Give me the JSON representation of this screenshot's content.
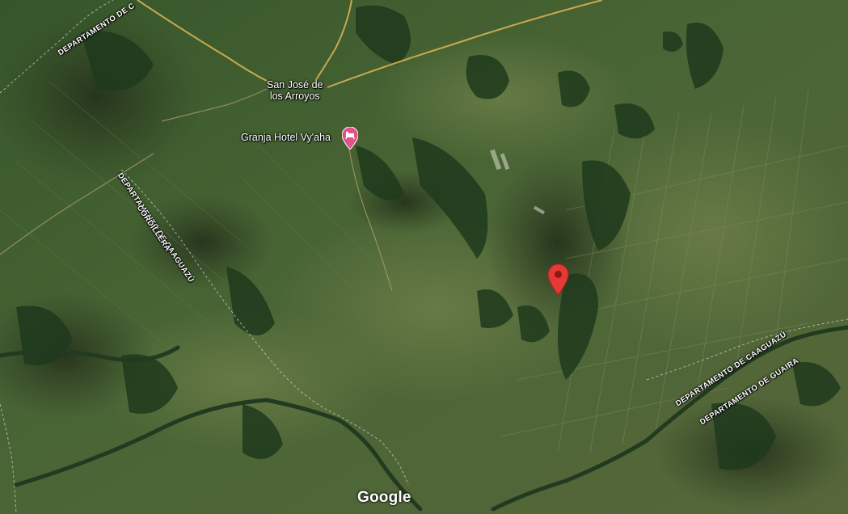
{
  "map": {
    "view": "satellite",
    "place_labels": {
      "town": "San José de los Arroyos",
      "town_line1": "San José de",
      "town_line2": "los Arroyos",
      "hotel": "Granja Hotel Vy'aha"
    },
    "department_labels": {
      "top_left_partial": "DEPARTAMENTO DE C",
      "caaguazu_left": "DEPARTAMENTO DE CAAGUAZÚ",
      "cordillera": "CORDILLERA",
      "caaguazu_right": "DEPARTAMENTO DE CAAGUAZÚ",
      "guaira": "DEPARTAMENTO DE GUAIRA"
    },
    "markers": {
      "selected_pin": "red-location-pin",
      "hotel_pin": "hotel-bed-pin"
    },
    "attribution": {
      "logo_text": "Google"
    },
    "colors": {
      "selected_pin": "#e53935",
      "hotel_pin": "#e4508a",
      "roads": "#c9a84e",
      "boundary": "#d8d8d8"
    }
  }
}
